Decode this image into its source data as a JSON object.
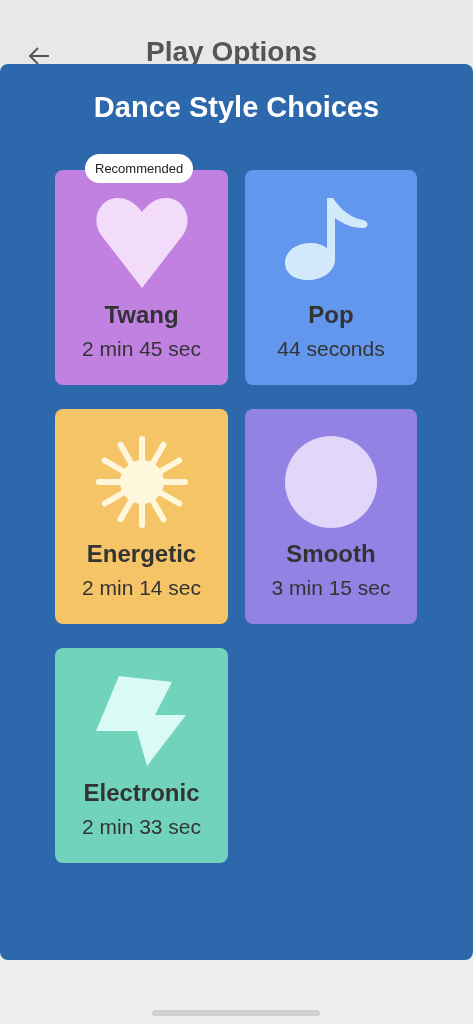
{
  "header": {
    "title": "Play Options"
  },
  "panel": {
    "title": "Dance Style Choices",
    "cards": [
      {
        "kind": "heart",
        "name": "Twang",
        "duration": "2 min 45 sec",
        "color": "#c181e1",
        "badge": "Recommended"
      },
      {
        "kind": "note",
        "name": "Pop",
        "duration": "44 seconds",
        "color": "#6396ed"
      },
      {
        "kind": "sun",
        "name": "Energetic",
        "duration": "2 min 14 sec",
        "color": "#f5c467"
      },
      {
        "kind": "circle",
        "name": "Smooth",
        "duration": "3 min 15 sec",
        "color": "#9282e4"
      },
      {
        "kind": "bolt",
        "name": "Electronic",
        "duration": "2 min 33 sec",
        "color": "#72d3bd"
      }
    ]
  }
}
